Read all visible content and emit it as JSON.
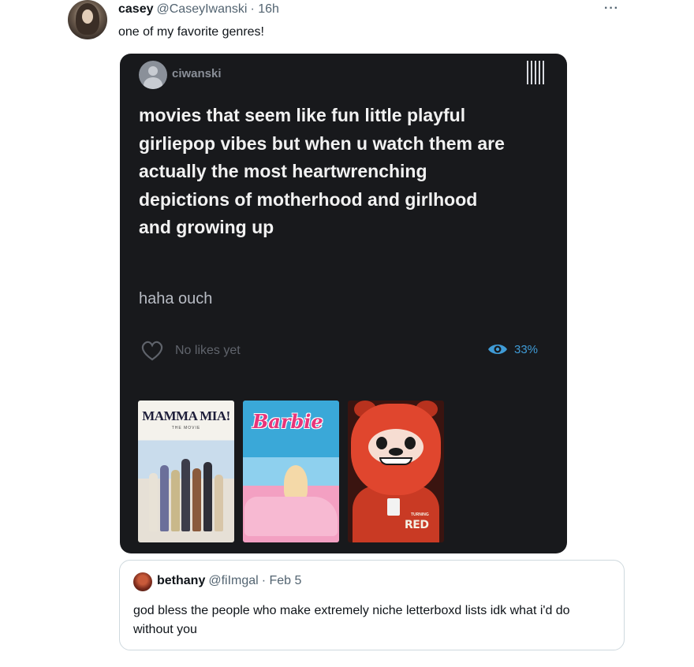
{
  "tweet": {
    "author_name": "casey",
    "author_handle": "@CaseyIwanski",
    "time": "· 16h",
    "text": "one of my favorite genres!",
    "more_label": "···"
  },
  "embedded_post": {
    "username": "ciwanski",
    "body": "movies that seem like fun little playful girliepop vibes but when u watch them are actually the most heartwrenching depictions of motherhood and girlhood and growing up",
    "subtext": "haha ouch",
    "likes_label": "No likes yet",
    "views_label": "33%",
    "posters": [
      {
        "title": "MAMMA MIA!",
        "subtitle": "THE MOVIE"
      },
      {
        "title": "Barbie"
      },
      {
        "title": "RED",
        "subtitle": "TURNING"
      }
    ]
  },
  "quote": {
    "author_name": "bethany",
    "author_handle": "@fiImgal",
    "time": "· Feb 5",
    "text": "god bless the people who make extremely niche letterboxd lists idk what i'd do without you"
  },
  "colors": {
    "card_bg": "#18191c",
    "accent_blue": "#3f9bd6",
    "barbie_pink": "#e8357a",
    "red_panda": "#e0462e"
  },
  "icons": {
    "menu": "menu-bars-icon",
    "heart": "heart-icon",
    "eye": "eye-icon"
  }
}
